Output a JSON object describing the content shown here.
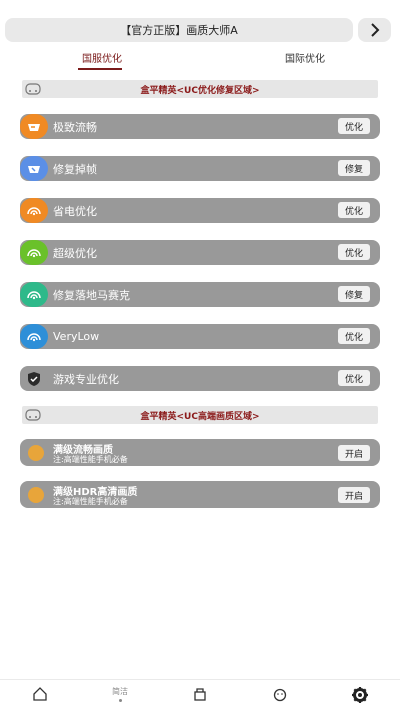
{
  "header": {
    "title": "【官方正版】画质大师A",
    "next_icon": "chevron-right-icon"
  },
  "tabs": [
    {
      "label": "国服优化",
      "active": true
    },
    {
      "label": "国际优化",
      "active": false
    }
  ],
  "sections": [
    {
      "title": "盒平精英<UC优化修复区域>",
      "icon": "gamepad-icon"
    },
    {
      "title": "盒平精英<UC高端画质区域>",
      "icon": "gamepad-icon"
    }
  ],
  "rows": [
    {
      "label": "极致流畅",
      "button": "优化",
      "icon": "speed-icon",
      "color": "#f08a24"
    },
    {
      "label": "修复掉帧",
      "button": "修复",
      "icon": "gauge-icon",
      "color": "#5b8fe6"
    },
    {
      "label": "省电优化",
      "button": "优化",
      "icon": "signal-icon",
      "color": "#f08a24"
    },
    {
      "label": "超级优化",
      "button": "优化",
      "icon": "signal-icon",
      "color": "#6ac12a"
    },
    {
      "label": "修复落地马赛克",
      "button": "修复",
      "icon": "signal-icon",
      "color": "#2eb98a"
    },
    {
      "label": "VeryLow",
      "button": "优化",
      "icon": "signal-icon",
      "color": "#2e8fd8"
    },
    {
      "label": "游戏专业优化",
      "button": "优化",
      "icon": "shield-check-icon",
      "color": "#2b2b2b"
    }
  ],
  "hd_rows": [
    {
      "title": "满级流畅画质",
      "subtitle": "注:高端性能手机必备",
      "button": "开启"
    },
    {
      "title": "满级HDR高清画质",
      "subtitle": "注:高端性能手机必备",
      "button": "开启"
    }
  ],
  "bottom_nav": [
    {
      "label": "",
      "icon": "home-icon"
    },
    {
      "label": "简洁",
      "icon": ""
    },
    {
      "label": "",
      "icon": "gift-icon"
    },
    {
      "label": "",
      "icon": "face-icon"
    },
    {
      "label": "",
      "icon": "gear-icon"
    }
  ]
}
